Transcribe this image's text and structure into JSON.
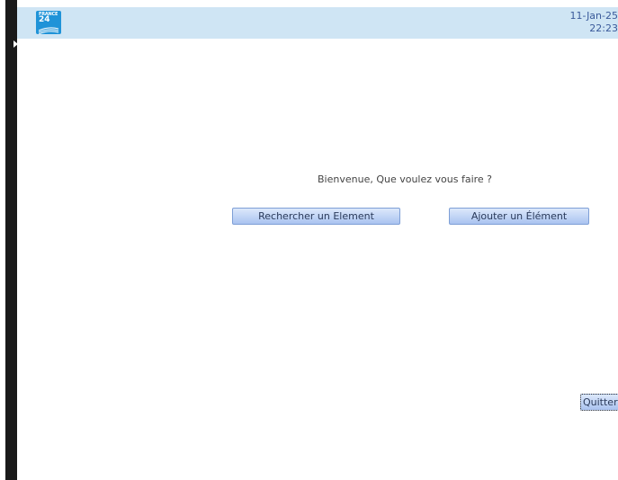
{
  "header": {
    "logo_text_top": "FRANCE",
    "logo_text_num": "24",
    "date": "11-Jan-25",
    "time": "22:23"
  },
  "main": {
    "welcome_text": "Bienvenue, Que voulez vous faire ?",
    "search_button_label": "Rechercher un Element",
    "add_button_label": "Ajouter un Élément",
    "quit_button_label": "Quitter"
  },
  "colors": {
    "header_bg": "#cfe5f4",
    "button_bg_top": "#dce8fb",
    "button_bg_bottom": "#a9c3f0",
    "button_border": "#7e9fd6",
    "side_bar": "#1a1a1a",
    "logo_bg": "#1f93d8"
  }
}
